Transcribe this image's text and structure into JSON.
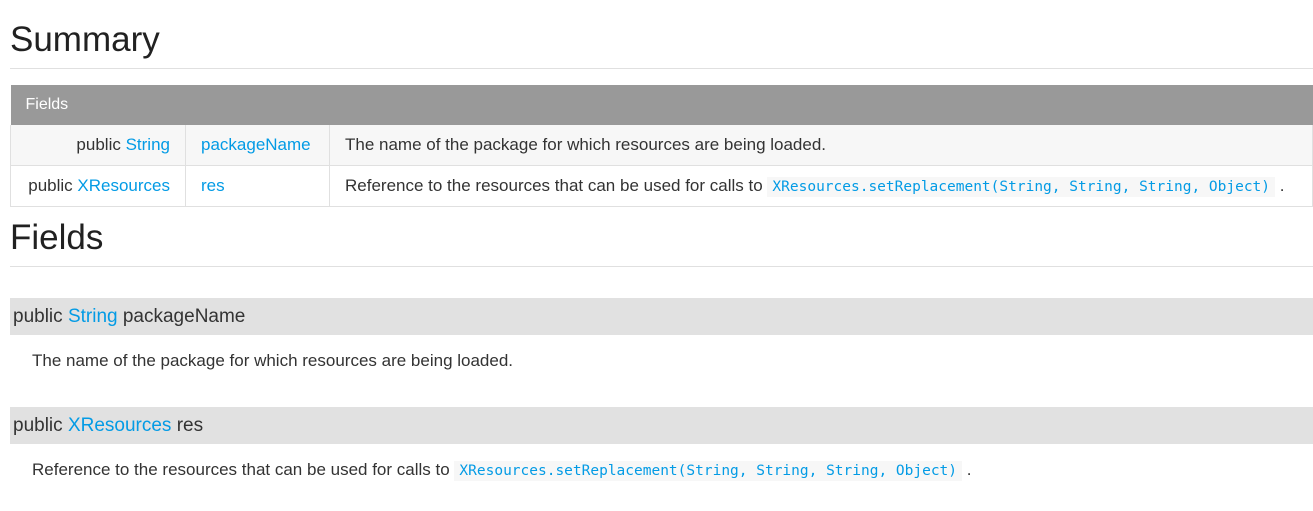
{
  "summary": {
    "title": "Summary",
    "table": {
      "header": "Fields",
      "rows": [
        {
          "modifier": "public",
          "type": "String",
          "name": "packageName",
          "description": "The name of the package for which resources are being loaded.",
          "code": "",
          "trailing": ""
        },
        {
          "modifier": "public",
          "type": "XResources",
          "name": "res",
          "description": "Reference to the resources that can be used for calls to",
          "code": "XResources.setReplacement(String, String, String, Object)",
          "trailing": "."
        }
      ]
    }
  },
  "fields": {
    "title": "Fields",
    "members": [
      {
        "modifier": "public",
        "type": "String",
        "name": "packageName",
        "description": "The name of the package for which resources are being loaded.",
        "code": "",
        "trailing": ""
      },
      {
        "modifier": "public",
        "type": "XResources",
        "name": "res",
        "description": "Reference to the resources that can be used for calls to",
        "code": "XResources.setReplacement(String, String, String, Object)",
        "trailing": "."
      }
    ]
  },
  "colors": {
    "link": "#039be5",
    "table_header_bg": "#999999",
    "member_header_bg": "#e1e1e1"
  }
}
